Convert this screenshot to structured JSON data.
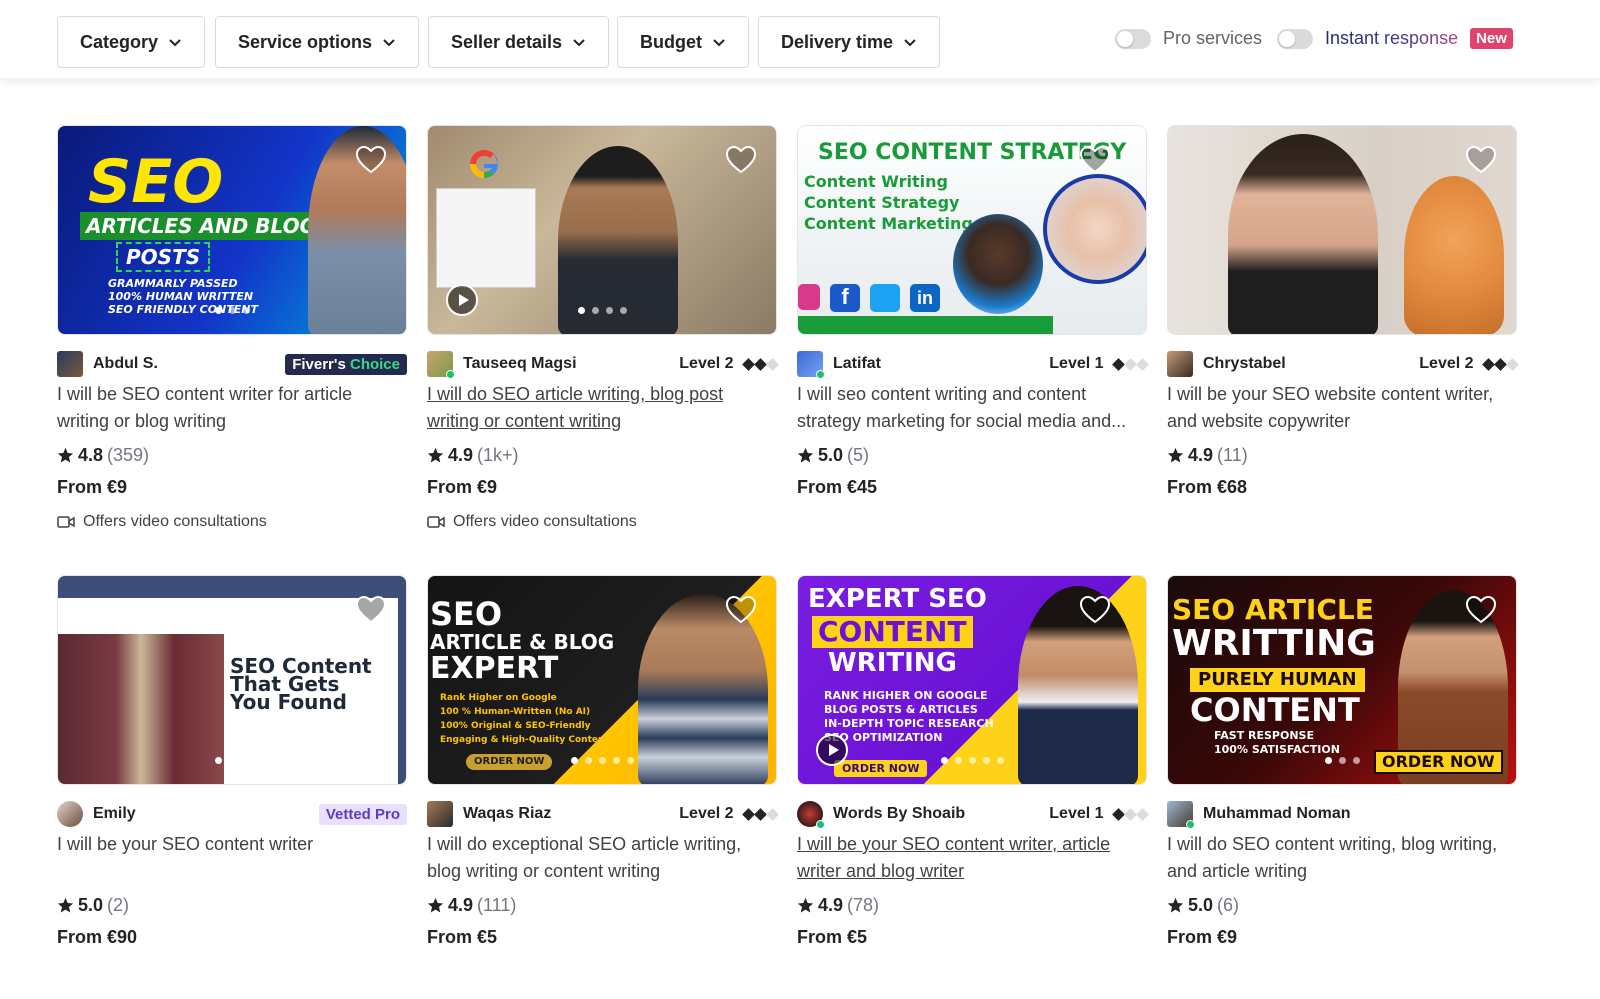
{
  "filters": {
    "category": "Category",
    "service_options": "Service options",
    "seller_details": "Seller details",
    "budget": "Budget",
    "delivery_time": "Delivery time",
    "pro_services": "Pro services",
    "instant_response": "Instant response",
    "new_badge": "New"
  },
  "gigs": [
    {
      "seller": "Abdul S.",
      "badge": "Fiverr's",
      "badge_suffix": "Choice",
      "title": "I will be SEO content writer for article writing or blog writing",
      "rating": "4.8",
      "count": "(359)",
      "price": "From €9",
      "video": "Offers video consultations",
      "thumb": {
        "line1": "SEO",
        "line2": "ARTICLES AND BLOG",
        "line3": "POSTS",
        "b1": "GRAMMARLY PASSED",
        "b2": "100% HUMAN WRITTEN",
        "b3": "SEO FRIENDLY CONTENT"
      }
    },
    {
      "seller": "Tauseeq Magsi",
      "level": "Level 2",
      "title": "I will do SEO article writing, blog post writing or content writing",
      "rating": "4.9",
      "count": "(1k+)",
      "price": "From €9",
      "video": "Offers video consultations"
    },
    {
      "seller": "Latifat",
      "level": "Level 1",
      "title": "I will seo content writing and content strategy marketing for social media and...",
      "rating": "5.0",
      "count": "(5)",
      "price": "From €45",
      "thumb": {
        "head": "SEO CONTENT STRATEGY",
        "l1": "Content Writing",
        "l2": "Content Strategy",
        "l3": "Content Marketing"
      }
    },
    {
      "seller": "Chrystabel",
      "level": "Level 2",
      "title": "I will be your SEO website content writer, and website copywriter",
      "rating": "4.9",
      "count": "(11)",
      "price": "From €68"
    },
    {
      "seller": "Emily",
      "badge": "Vetted Pro",
      "title": "I will be your SEO content writer",
      "rating": "5.0",
      "count": "(2)",
      "price": "From €90",
      "thumb": {
        "l1": "SEO Content",
        "l2": "That Gets",
        "l3": "You Found"
      }
    },
    {
      "seller": "Waqas Riaz",
      "level": "Level 2",
      "title": "I will do exceptional SEO article writing, blog writing or content writing",
      "rating": "4.9",
      "count": "(111)",
      "price": "From €5",
      "thumb": {
        "l1": "SEO",
        "l2": "ARTICLE & BLOG",
        "l3": "EXPERT",
        "b1": "Rank Higher on Google",
        "b2": "100 % Human-Written (No AI)",
        "b3": "100% Original & SEO-Friendly",
        "b4": "Engaging & High-Quality Content",
        "cta": "ORDER NOW"
      }
    },
    {
      "seller": "Words By Shoaib",
      "level": "Level 1",
      "title": "I will be your SEO content writer, article writer and blog writer",
      "rating": "4.9",
      "count": "(78)",
      "price": "From €5",
      "thumb": {
        "l1": "EXPERT SEO",
        "l2": "CONTENT",
        "l3": "WRITING",
        "b1": "RANK HIGHER ON GOOGLE",
        "b2": "BLOG POSTS & ARTICLES",
        "b3": "IN-DEPTH TOPIC RESEARCH",
        "b4": "SEO OPTIMIZATION",
        "cta": "ORDER NOW"
      }
    },
    {
      "seller": "Muhammad Noman",
      "title": "I will do SEO content writing, blog writing, and article writing",
      "rating": "5.0",
      "count": "(6)",
      "price": "From €9",
      "thumb": {
        "l1": "SEO ARTICLE",
        "l2": "WRITTING",
        "l3": "PURELY HUMAN",
        "l4": "CONTENT",
        "b1": "FAST RESPONSE",
        "b2": "100% SATISFACTION",
        "cta": "ORDER NOW"
      }
    }
  ],
  "colors": {
    "accent_green": "#1dbf73",
    "new_badge": "#e0436b",
    "vetted_bg": "#e9e0ff",
    "choice_bg": "#222a4d"
  },
  "icons": {
    "heart": "heart-icon",
    "star": "star-icon",
    "chevron": "chevron-down-icon",
    "video": "video-camera-icon"
  }
}
